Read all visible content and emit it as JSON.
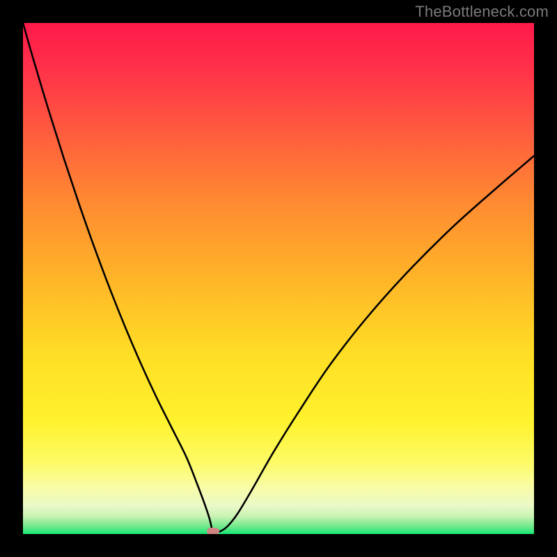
{
  "watermark": "TheBottleneck.com",
  "colors": {
    "frame": "#000000",
    "watermark": "#7b7b7b",
    "curve": "#000000",
    "marker": "#d08585",
    "gradient_stops": [
      {
        "offset": 0.0,
        "color": "#ff1a4b"
      },
      {
        "offset": 0.08,
        "color": "#ff2e4a"
      },
      {
        "offset": 0.2,
        "color": "#ff5740"
      },
      {
        "offset": 0.35,
        "color": "#ff8a32"
      },
      {
        "offset": 0.5,
        "color": "#ffb528"
      },
      {
        "offset": 0.65,
        "color": "#ffde25"
      },
      {
        "offset": 0.78,
        "color": "#fff22e"
      },
      {
        "offset": 0.86,
        "color": "#fdfb66"
      },
      {
        "offset": 0.91,
        "color": "#f8fca8"
      },
      {
        "offset": 0.945,
        "color": "#eaf9c7"
      },
      {
        "offset": 0.965,
        "color": "#c9f3b3"
      },
      {
        "offset": 0.985,
        "color": "#71e98c"
      },
      {
        "offset": 1.0,
        "color": "#17e876"
      }
    ]
  },
  "chart_data": {
    "type": "line",
    "title": "",
    "xlabel": "",
    "ylabel": "",
    "xlim": [
      0,
      100
    ],
    "ylim": [
      0,
      100
    ],
    "grid": false,
    "legend": false,
    "series": [
      {
        "name": "bottleneck-curve",
        "x": [
          0,
          2,
          5,
          8,
          11,
          14,
          17,
          20,
          23,
          26,
          29,
          32,
          34,
          35.5,
          36.5,
          37,
          37.5,
          38.5,
          40,
          42,
          45,
          49,
          54,
          60,
          67,
          75,
          84,
          93,
          100
        ],
        "y": [
          100,
          93,
          83,
          73.5,
          64.5,
          56,
          48,
          40.5,
          33.5,
          27,
          21,
          15,
          10,
          6,
          3,
          1,
          0.5,
          0.5,
          1.5,
          4,
          9,
          16,
          24,
          33,
          42,
          51,
          60,
          68,
          74
        ]
      }
    ],
    "marker": {
      "x": 37.2,
      "y": 0.5
    },
    "background": "vertical-gradient-red-to-green"
  }
}
